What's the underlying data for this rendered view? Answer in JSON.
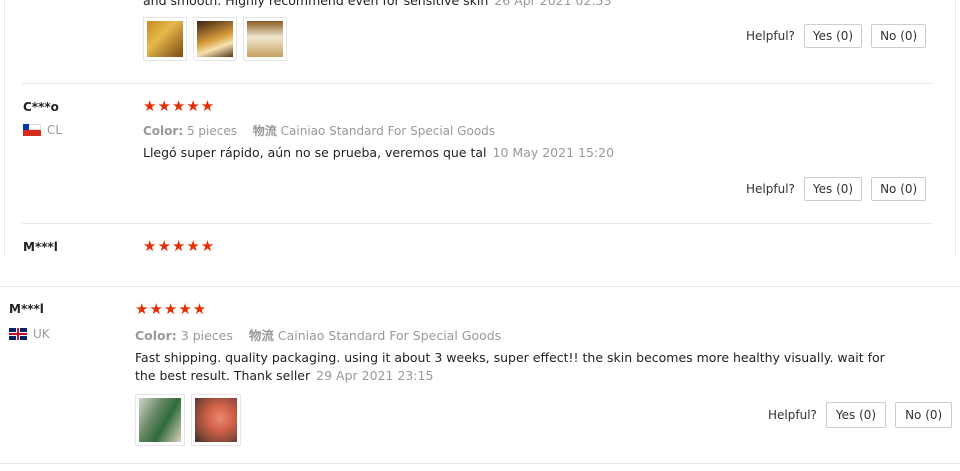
{
  "reviews": [
    {
      "text_partial": "and smooth. Highly recommend even for sensitive skin",
      "date": "26 Apr 2021 02:53",
      "helpful_label": "Helpful?",
      "yes_label": "Yes (0)",
      "no_label": "No (0)"
    },
    {
      "name": "C***o",
      "country": "CL",
      "color_label": "Color:",
      "color_value": "5 pieces",
      "logistics_label": "物流",
      "logistics_value": "Cainiao Standard For Special Goods",
      "text": "Llegó super rápido, aún no se prueba, veremos que tal",
      "date": "10 May 2021 15:20",
      "helpful_label": "Helpful?",
      "yes_label": "Yes (0)",
      "no_label": "No (0)",
      "stars": "★★★★★"
    },
    {
      "name": "M***l",
      "stars": "★★★★★"
    },
    {
      "name": "M***l",
      "country": "UK",
      "color_label": "Color:",
      "color_value": "3 pieces",
      "logistics_label": "物流",
      "logistics_value": "Cainiao Standard For Special Goods",
      "text_line1": "Fast shipping. quality packaging. using it about 3 weeks, super effect!! the skin becomes more healthy visually. wait for",
      "text_line2": "the best result. Thank seller",
      "date": "29 Apr 2021 23:15",
      "helpful_label": "Helpful?",
      "yes_label": "Yes (0)",
      "no_label": "No (0)",
      "stars": "★★★★★"
    }
  ],
  "colors": {
    "star": "#e62e04",
    "muted": "#999999",
    "border": "#cccccc"
  }
}
